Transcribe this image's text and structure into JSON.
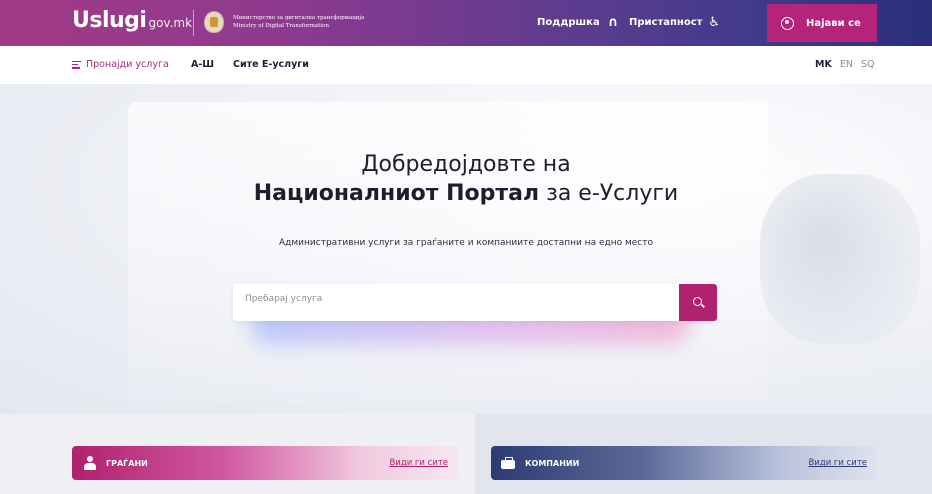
{
  "header": {
    "logo_main": "Uslugi",
    "logo_sub": "gov.mk",
    "ministry_line1": "Министерство за дигитална трансформација",
    "ministry_line2": "Ministry of Digital Transformation",
    "support_label": "Поддршка",
    "accessibility_label": "Пристапност",
    "login_label": "Најави се"
  },
  "subnav": {
    "find_service": "Пронајди услуга",
    "az": "А-Ш",
    "all_services": "Сите Е-услуги",
    "languages": [
      "MK",
      "EN",
      "SQ"
    ],
    "active_language": "MK"
  },
  "hero": {
    "title_line1": "Добредојдовте на",
    "title_line2_bold": "Националниот Портал",
    "title_line2_rest": " за е-Услуги",
    "subtitle": "Административни услуги за граѓаните и компаниите достапни на едно место",
    "search_placeholder": "Пребарај услуга"
  },
  "sections": {
    "citizens_label": "ГРАЃАНИ",
    "citizens_see_all": "Види ги сите",
    "companies_label": "КОМПАНИИ",
    "companies_see_all": "Види ги сите"
  },
  "colors": {
    "brand_magenta": "#b0216f",
    "brand_navy": "#2c3b72"
  }
}
